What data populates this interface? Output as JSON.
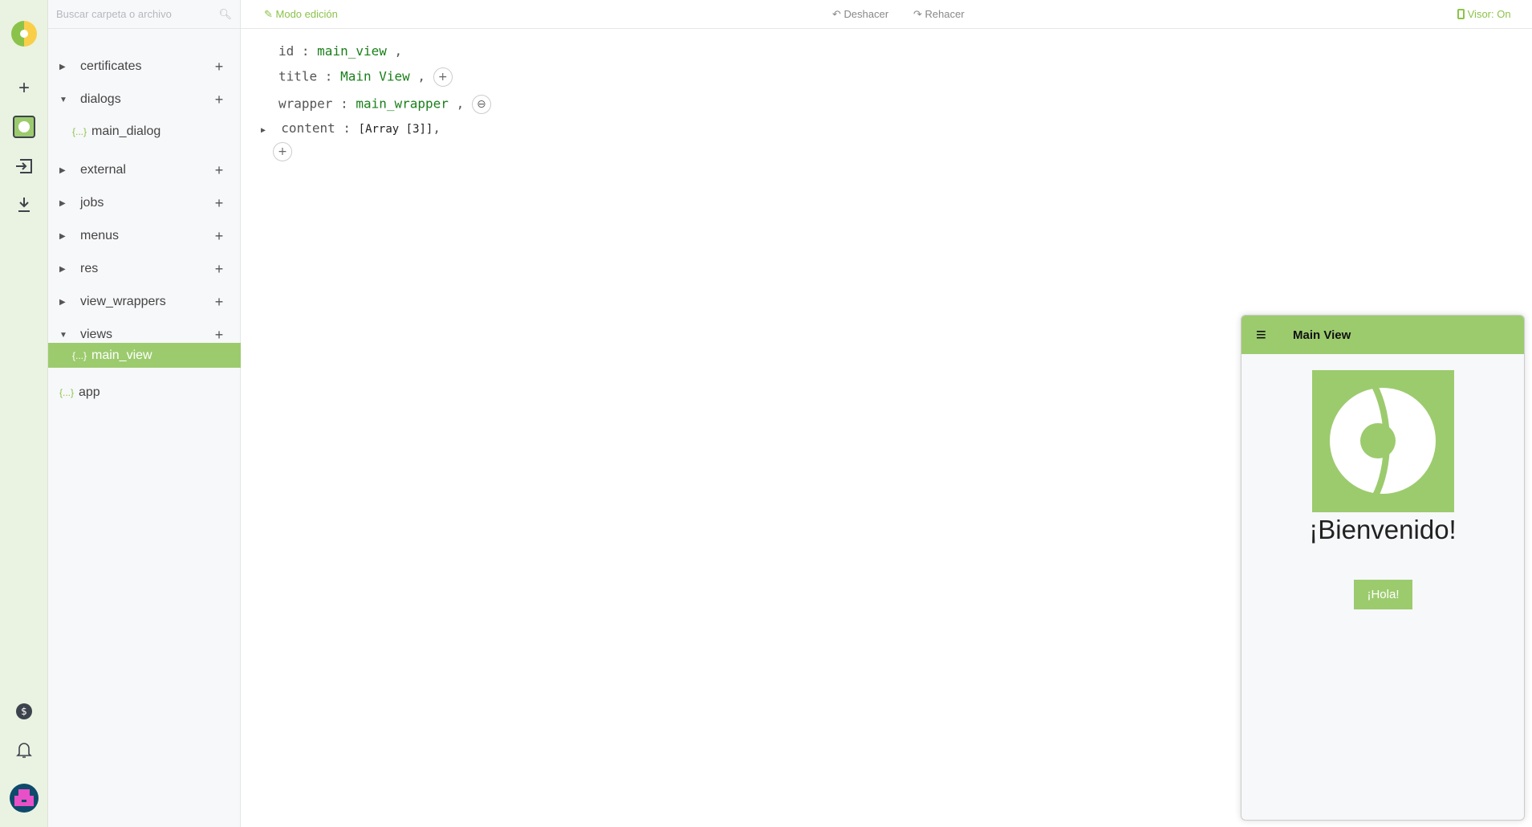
{
  "search": {
    "placeholder": "Buscar carpeta o archivo"
  },
  "tree": [
    {
      "label": "certificates",
      "expanded": false
    },
    {
      "label": "dialogs",
      "expanded": true
    },
    {
      "label": "main_dialog",
      "type": "file"
    },
    {
      "label": "external",
      "expanded": false
    },
    {
      "label": "jobs",
      "expanded": false
    },
    {
      "label": "menus",
      "expanded": false
    },
    {
      "label": "res",
      "expanded": false
    },
    {
      "label": "view_wrappers",
      "expanded": false
    },
    {
      "label": "views",
      "expanded": true
    },
    {
      "label": "main_view",
      "type": "file",
      "selected": true
    },
    {
      "label": "app",
      "type": "file"
    }
  ],
  "file_icon": "{...}",
  "toolbar": {
    "mode": "Modo edición",
    "undo": "Deshacer",
    "redo": "Rehacer",
    "viewer": "Visor: On"
  },
  "editor": {
    "id_key": "id",
    "id_val": "main_view",
    "title_key": "title",
    "title_val": "Main View",
    "wrapper_key": "wrapper",
    "wrapper_val": "main_wrapper",
    "content_key": "content",
    "content_val": "[Array [3]]"
  },
  "preview": {
    "title": "Main View",
    "welcome": "¡Bienvenido!",
    "button": "¡Hola!"
  },
  "colors": {
    "accent": "#9ccb6e",
    "avatar": "#e94fc6"
  }
}
